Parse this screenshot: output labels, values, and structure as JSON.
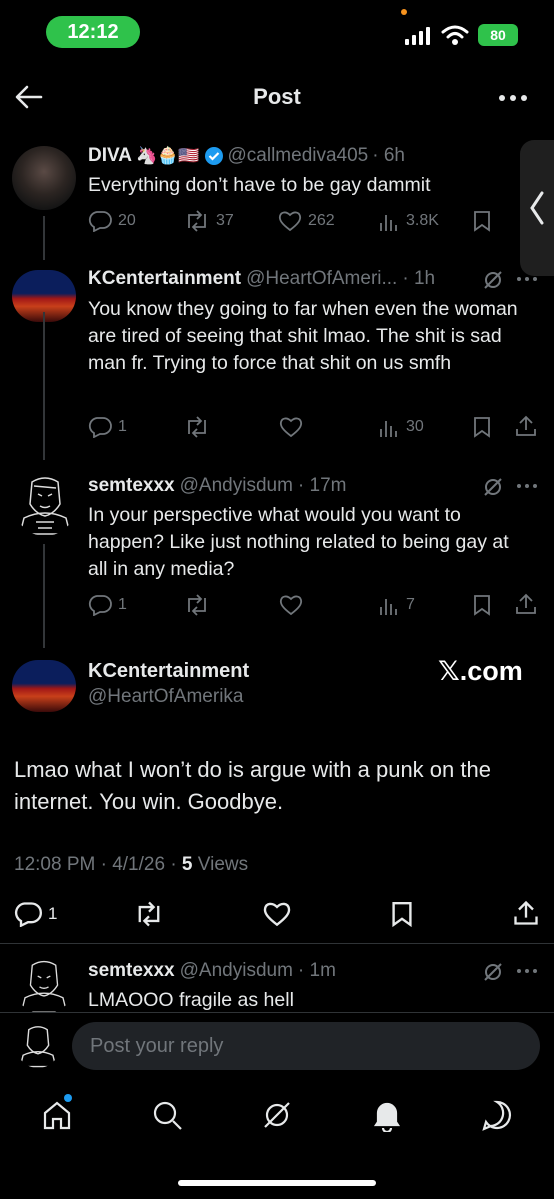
{
  "status_bar": {
    "time": "12:12",
    "battery": "80"
  },
  "header": {
    "title": "Post"
  },
  "replies": [
    {
      "name": "DIVA",
      "emoji": "🦄🧁🇺🇸",
      "handle": "@callmediva405",
      "time": "· 6h",
      "text": "Everything don’t have to be gay dammit",
      "replies": "20",
      "reposts": "37",
      "likes": "262",
      "views": "3.8K"
    },
    {
      "name": "KCentertainment",
      "handle": "@HeartOfAmeri...",
      "time": "· 1h",
      "text": "You know they going to far when even the woman are tired of seeing that shit lmao. The shit is sad man fr. Trying to force that shit on us smfh",
      "replies": "1",
      "views": "30"
    },
    {
      "name": "semtexxx",
      "handle": "@Andyisdum",
      "time": "· 17m",
      "text": "In your perspective what would you want to happen? Like just nothing related to being gay at all in any media?",
      "replies": "1",
      "views": "7"
    }
  ],
  "main_post": {
    "name": "KCentertainment",
    "handle": "@HeartOfAmerika",
    "watermark": "𝕏.com",
    "text": "Lmao what I won’t do is argue with a punk on the internet. You win. Goodbye.",
    "time": "12:08 PM · 4/1/26 · ",
    "views_count": "5",
    "views_label": " Views",
    "replies": "1"
  },
  "last_reply": {
    "name": "semtexxx",
    "handle": "@Andyisdum",
    "time": "· 1m",
    "text": "LMAOOO fragile as hell"
  },
  "reply_box": {
    "placeholder": "Post your reply"
  },
  "colors": {
    "background": "#000000",
    "text": "#e7e9ea",
    "muted": "#71767b",
    "accent": "#1d9bf0",
    "status_green": "#2fc24b"
  },
  "icons": [
    "back-arrow-icon",
    "more-icon",
    "verified-icon",
    "reply-icon",
    "repost-icon",
    "like-icon",
    "views-icon",
    "bookmark-icon",
    "share-icon",
    "grok-icon",
    "home-icon",
    "search-icon",
    "bell-icon",
    "messages-icon"
  ]
}
